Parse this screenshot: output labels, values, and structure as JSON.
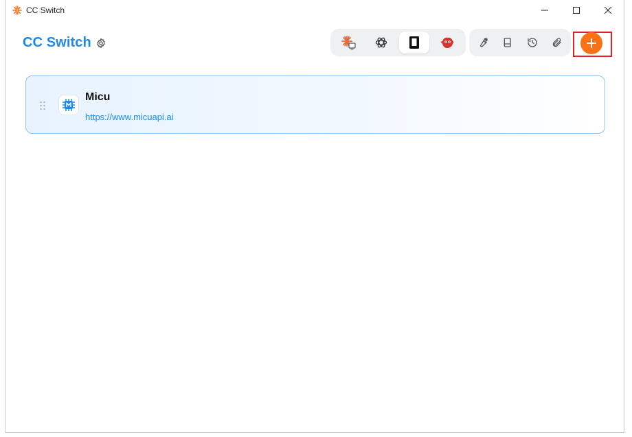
{
  "window": {
    "title": "CC Switch",
    "icon": "starburst-logo-icon",
    "controls": [
      "minimize-icon",
      "maximize-icon",
      "close-icon"
    ]
  },
  "header": {
    "app_title": "CC Switch",
    "settings_icon": "gear-icon",
    "app_switcher": [
      {
        "icon": "claude-code-icon",
        "active": false
      },
      {
        "icon": "openai-icon",
        "active": false
      },
      {
        "icon": "gemini-icon",
        "active": true
      },
      {
        "icon": "red-bird-icon",
        "active": false
      }
    ],
    "tools": [
      "wrench-icon",
      "book-icon",
      "history-icon",
      "paperclip-icon"
    ],
    "add_icon": "plus-icon",
    "colors": {
      "accent": "#1e88e5",
      "add_button": "#f97316",
      "highlight": "#e02424"
    }
  },
  "providers": [
    {
      "name": "Micu",
      "url": "https://www.micuapi.ai",
      "icon": "chip-m-icon",
      "selected": true
    }
  ]
}
